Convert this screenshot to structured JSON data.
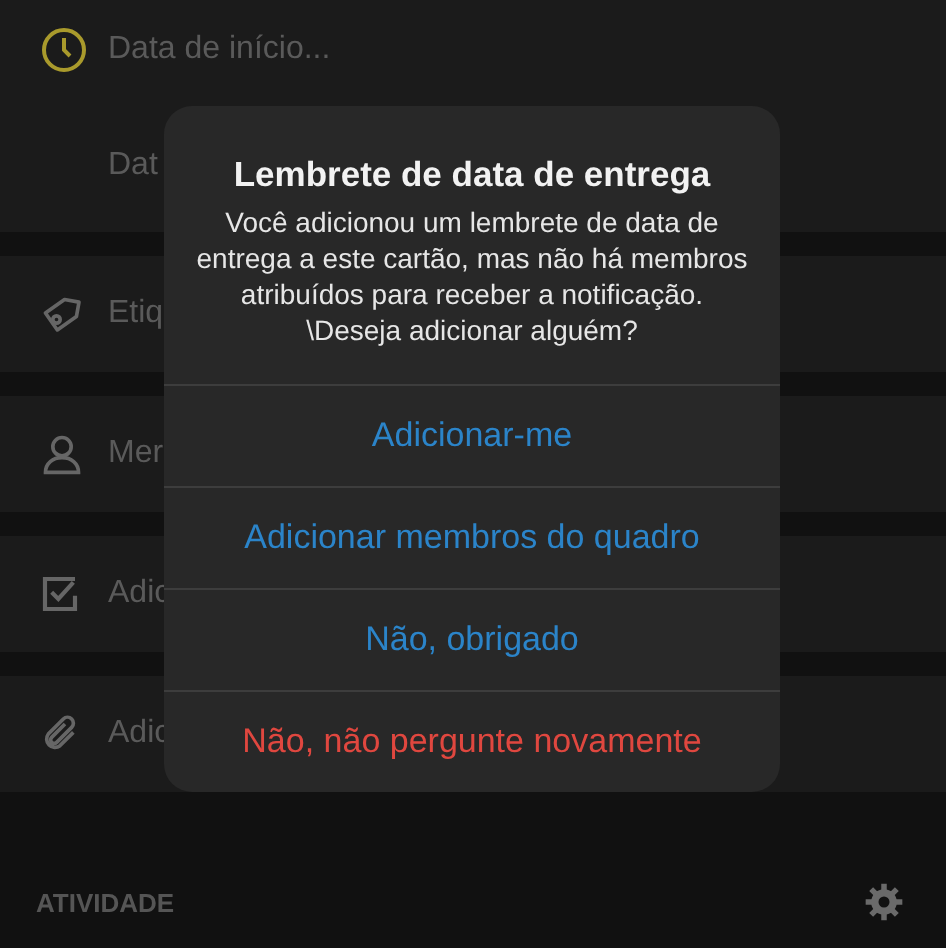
{
  "rows": [
    {
      "kind": "clock",
      "label": "Data de início..."
    },
    {
      "kind": "plain",
      "label": "Dat"
    },
    {
      "kind": "tag",
      "label": "Etiq"
    },
    {
      "kind": "person",
      "label": "Mer"
    },
    {
      "kind": "check",
      "label": "Adic"
    },
    {
      "kind": "clip",
      "label": "Adic"
    }
  ],
  "activity": {
    "label": "ATIVIDADE"
  },
  "dialog": {
    "title": "Lembrete de data de entrega",
    "message": "Você adicionou um lembrete de data de entrega a este cartão, mas não há membros atribuídos para receber a notificação.\n\\Deseja adicionar alguém?",
    "actions": [
      {
        "label": "Adicionar-me",
        "kind": "default"
      },
      {
        "label": "Adicionar membros do quadro",
        "kind": "default"
      },
      {
        "label": "Não, obrigado",
        "kind": "default"
      },
      {
        "label": "Não, não pergunte novamente",
        "kind": "destructive"
      }
    ]
  }
}
